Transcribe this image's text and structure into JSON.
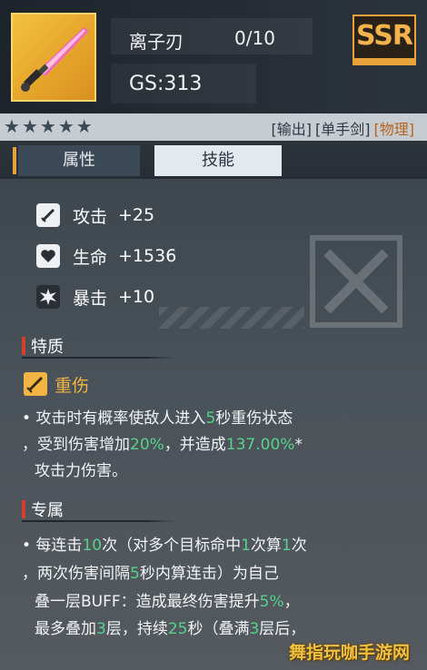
{
  "item": {
    "name": "离子刃",
    "level": "0/10",
    "gs": "GS:313",
    "rarity": "SSR",
    "stars": [
      "star-icon",
      "star-icon",
      "star-icon",
      "star-icon",
      "star-icon"
    ],
    "tags": {
      "t1": "[输出]",
      "t2": "[单手剑]",
      "t3": "[物理]"
    }
  },
  "tabs": {
    "attributes": "属性",
    "skills": "技能"
  },
  "stats": [
    {
      "icon": "sword-icon",
      "label": "攻击",
      "value": "+25"
    },
    {
      "icon": "heart-icon",
      "label": "生命",
      "value": "+1536"
    },
    {
      "icon": "burst-icon",
      "label": "暴击",
      "value": "+10"
    }
  ],
  "trait": {
    "section": "特质",
    "name": "重伤",
    "l1a": "• 攻击时有概率使敌人进入",
    "l1b": "5",
    "l1c": "秒重伤状态",
    "l2a": "，受到伤害增加",
    "l2b": "20%",
    "l2c": "，并造成",
    "l2d": "137.00%",
    "l2e": "*",
    "l3": "攻击力伤害。"
  },
  "exclusive": {
    "section": "专属",
    "l1a": "• 每连击",
    "l1b": "10",
    "l1c": "次（对多个目标命中",
    "l1d": "1",
    "l1e": "次算",
    "l1f": "1",
    "l1g": "次",
    "l2a": "，两次伤害间隔",
    "l2b": "5",
    "l2c": "秒内算连击）为自己",
    "l3a": "叠一层BUFF：造成最终伤害提升",
    "l3b": "5%",
    "l3c": "，",
    "l4a": "最多叠加",
    "l4b": "3",
    "l4c": "层，持续",
    "l4d": "25",
    "l4e": "秒（叠满",
    "l4f": "3",
    "l4g": "层后，"
  },
  "watermark": "舞指玩咖手游网",
  "colors": {
    "rarity": "#e8a23a",
    "highlight": "#57d18a",
    "trait": "#f2b544",
    "physical": "#b5651d"
  }
}
